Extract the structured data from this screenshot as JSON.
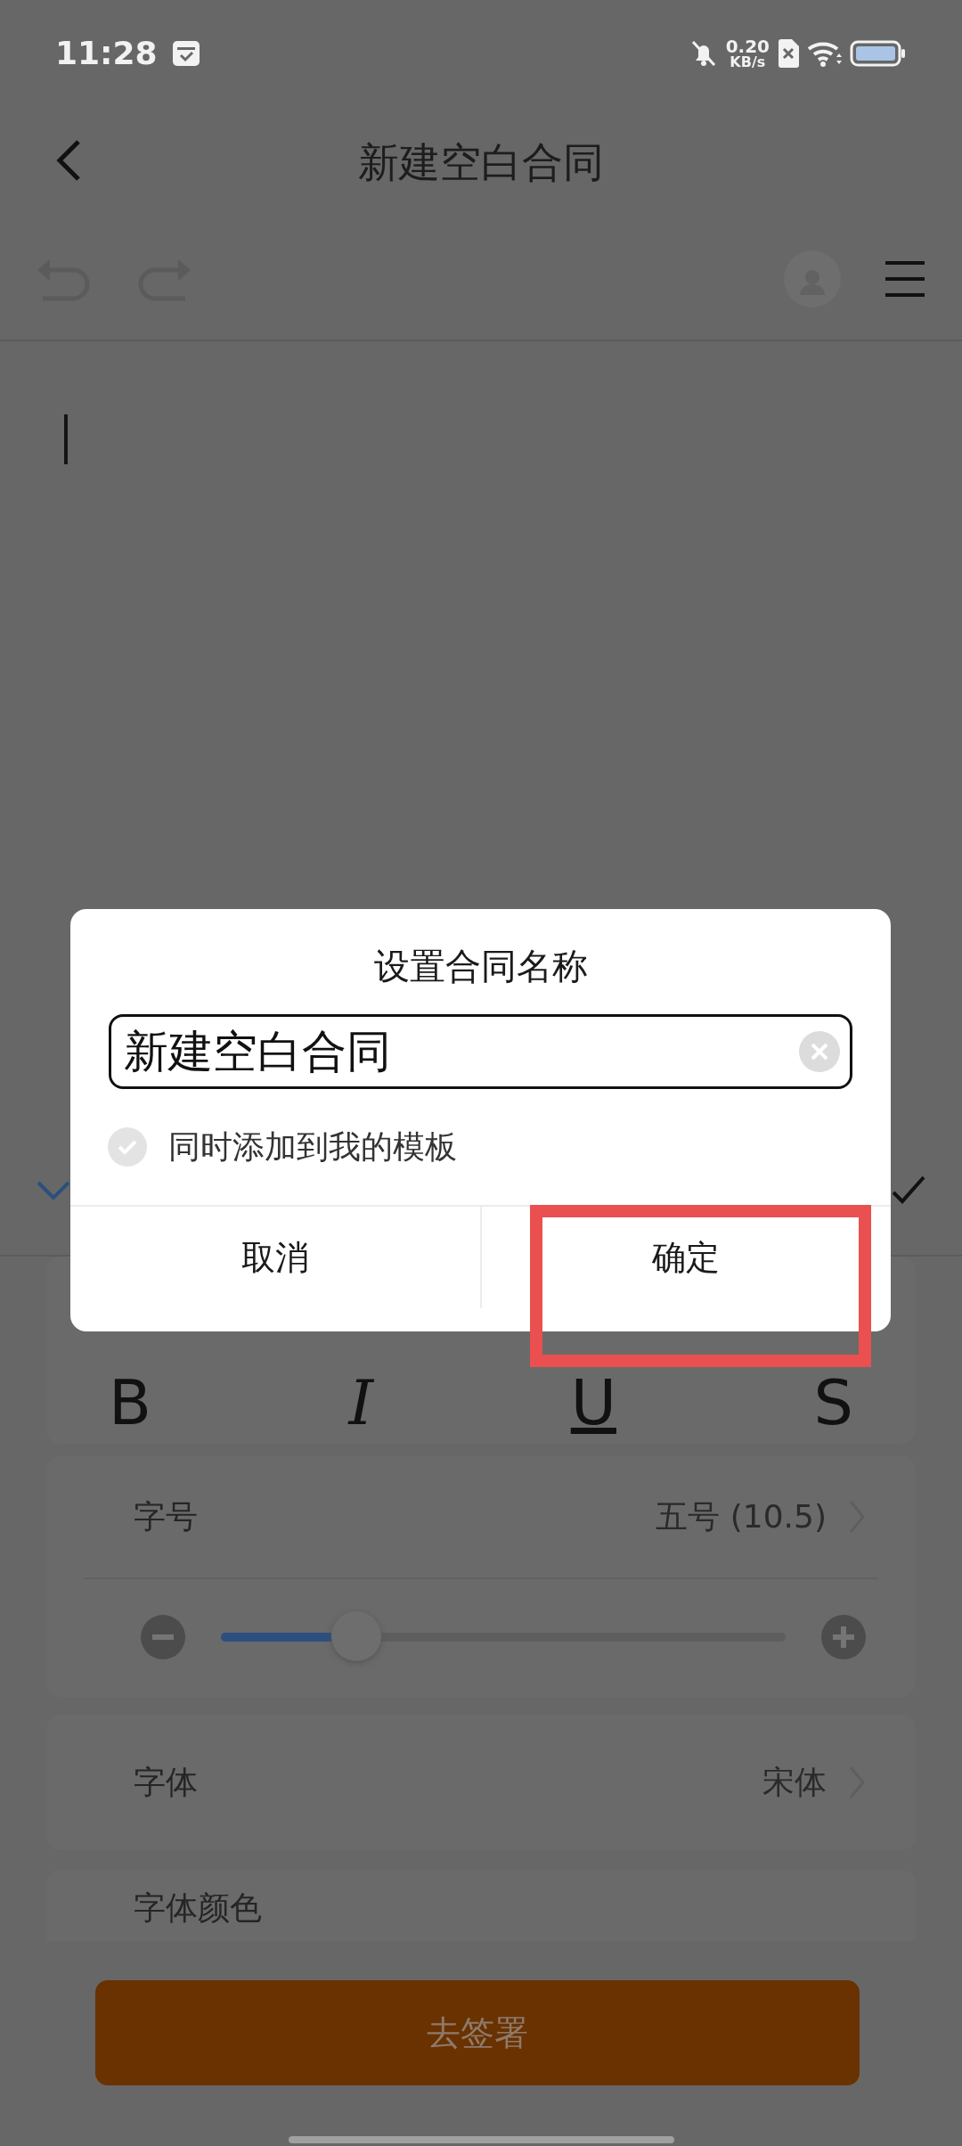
{
  "status_bar": {
    "time": "11:28",
    "net_speed_value": "0.20",
    "net_speed_unit": "KB/s"
  },
  "header": {
    "title": "新建空白合同"
  },
  "style_buttons": [
    {
      "label": "B",
      "kind": "bold"
    },
    {
      "label": "I",
      "kind": "italic"
    },
    {
      "label": "U",
      "kind": "underline"
    },
    {
      "label": "S",
      "kind": "strike"
    }
  ],
  "font_size": {
    "label": "字号",
    "value": "五号 (10.5)",
    "level": 0.24
  },
  "font": {
    "label": "字体",
    "value": "宋体"
  },
  "font_color": {
    "label": "字体颜色"
  },
  "sign_button": "去签署",
  "dialog": {
    "title": "设置合同名称",
    "name_value": "新建空白合同",
    "add_to_templates": {
      "label": "同时添加到我的模板",
      "checked": false
    },
    "buttons": [
      {
        "label": "取消",
        "kind": "cancel",
        "highlighted": false
      },
      {
        "label": "确定",
        "kind": "confirm",
        "highlighted": true
      }
    ]
  }
}
